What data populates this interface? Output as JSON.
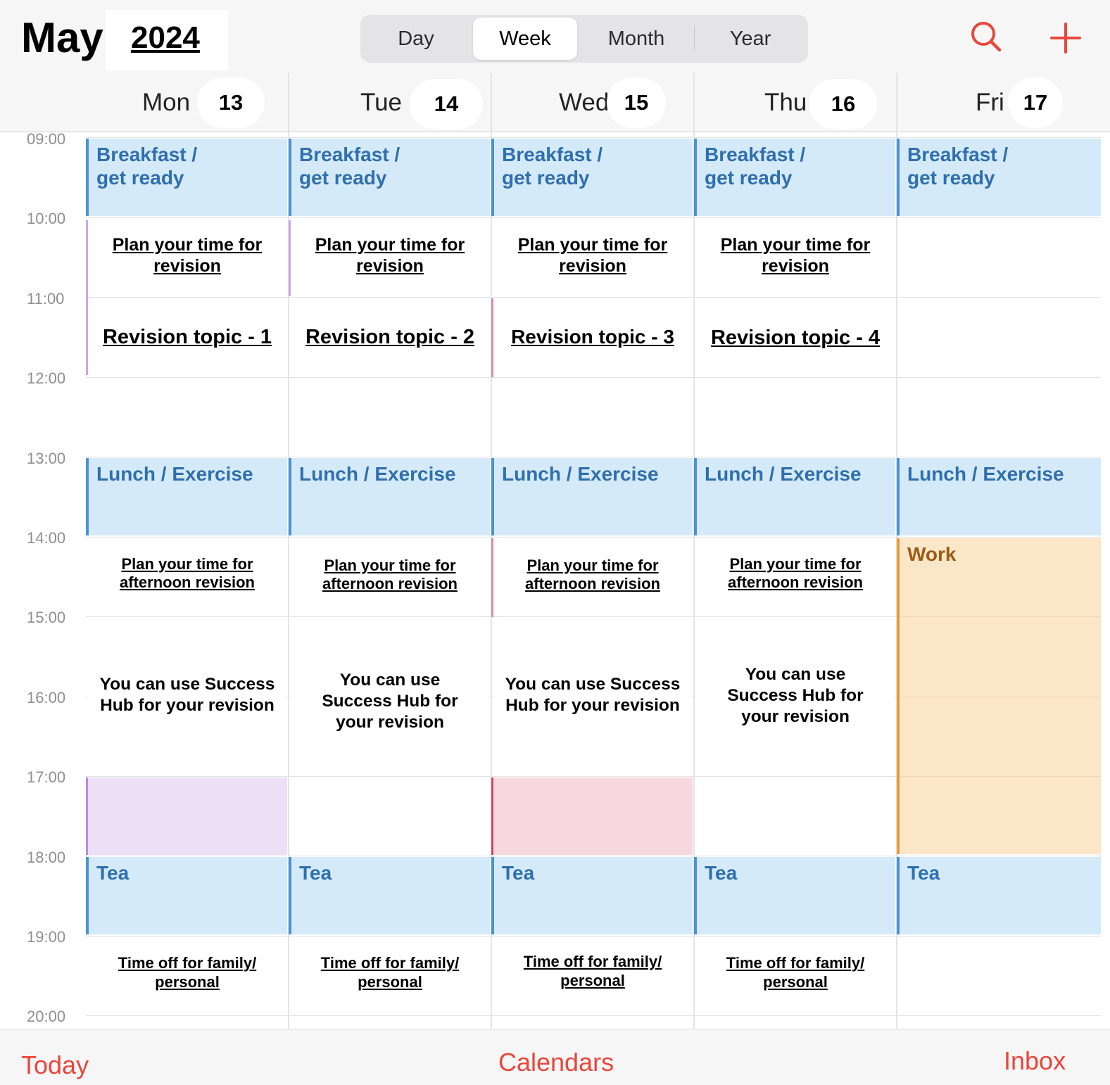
{
  "header": {
    "month": "May",
    "year": "2024",
    "view_tabs": [
      {
        "label": "Day",
        "selected": false
      },
      {
        "label": "Week",
        "selected": true
      },
      {
        "label": "Month",
        "selected": false
      },
      {
        "label": "Year",
        "selected": false
      }
    ],
    "icons": {
      "search": "search-icon",
      "add": "plus-icon"
    },
    "accent_color": "#e9463d"
  },
  "days": [
    {
      "name": "Mon",
      "date": "13"
    },
    {
      "name": "Tue",
      "date": "14"
    },
    {
      "name": "Wed",
      "date": "15"
    },
    {
      "name": "Thu",
      "date": "16"
    },
    {
      "name": "Fri",
      "date": "17"
    }
  ],
  "hours": [
    "09:00",
    "10:00",
    "11:00",
    "12:00",
    "13:00",
    "14:00",
    "15:00",
    "16:00",
    "17:00",
    "18:00",
    "19:00",
    "20:00"
  ],
  "events": {
    "breakfast": "Breakfast /\nget ready",
    "lunch": "Lunch / Exercise",
    "tea": "Tea",
    "work": "Work",
    "plan_morning": "Plan your time for revision",
    "revision_topics": [
      "Revision topic - 1",
      "Revision topic - 2",
      "Revision topic - 3",
      "Revision topic - 4"
    ],
    "plan_afternoon": "Plan your time for afternoon revision",
    "plan_afternoon_tue": "Plan your time for afternoon  revision",
    "success_hub": "You can use Success Hub for your revision",
    "time_off": "Time off for family/ personal"
  },
  "colors": {
    "routine_event": "#d5eaf8",
    "work_event": "#fbe6c8",
    "purple_block": "#ecdff6",
    "pink_block": "#f6d7e0"
  },
  "footer": {
    "today": "Today",
    "calendars": "Calendars",
    "inbox": "Inbox"
  }
}
